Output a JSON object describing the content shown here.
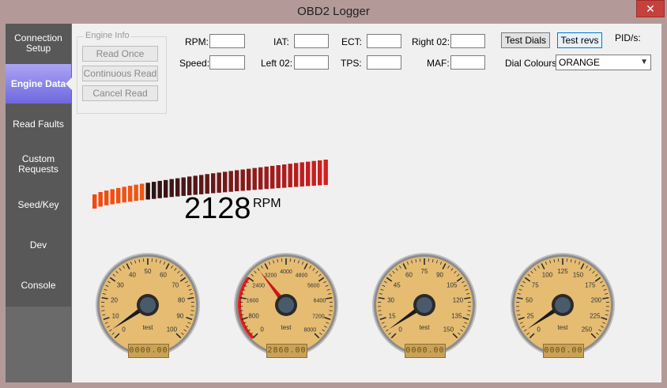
{
  "window": {
    "title": "OBD2 Logger",
    "close_glyph": "✕"
  },
  "sidebar": {
    "items": [
      {
        "label": "Connection Setup",
        "active": false
      },
      {
        "label": "Engine Data",
        "active": true
      },
      {
        "label": "Read Faults",
        "active": false
      },
      {
        "label": "Custom Requests",
        "active": false
      },
      {
        "label": "Seed/Key",
        "active": false
      },
      {
        "label": "Dev",
        "active": false
      },
      {
        "label": "Console",
        "active": false
      }
    ]
  },
  "engine_info": {
    "title": "Engine Info",
    "read_once": "Read Once",
    "continuous_read": "Continuous Read",
    "cancel_read": "Cancel Read"
  },
  "fields": {
    "rpm": {
      "label": "RPM:",
      "value": ""
    },
    "speed": {
      "label": "Speed:",
      "value": ""
    },
    "iat": {
      "label": "IAT:",
      "value": ""
    },
    "left_o2": {
      "label": "Left 02:",
      "value": ""
    },
    "ect": {
      "label": "ECT:",
      "value": ""
    },
    "tps": {
      "label": "TPS:",
      "value": ""
    },
    "right_o2": {
      "label": "Right 02:",
      "value": ""
    },
    "maf": {
      "label": "MAF:",
      "value": ""
    }
  },
  "controls": {
    "test_dials": "Test Dials",
    "test_revs": "Test revs",
    "pids_label": "PID/s:",
    "dial_colours_label": "Dial Colours:",
    "dial_colours_value": "ORANGE",
    "dropdown_arrow": "▼"
  },
  "rpm_bar": {
    "value": "2128",
    "unit": "RPM",
    "segments": 40,
    "lit_fraction": 0.23
  },
  "colors": {
    "accent_active": "#7a73e6",
    "dial_face": "#e5bc72",
    "redline": "#e02020",
    "bar_orange": "#f04a10",
    "bar_red": "#d42020"
  },
  "gauges": [
    {
      "ticks": [
        "0",
        "10",
        "20",
        "30",
        "40",
        "50",
        "60",
        "70",
        "80",
        "90",
        "100"
      ],
      "label": "test",
      "needle_fraction": 0.04,
      "odometer": "0000.00",
      "redline": false
    },
    {
      "ticks": [
        "0",
        "800",
        "1600",
        "2400",
        "3200",
        "4000",
        "4800",
        "5600",
        "6400",
        "7200",
        "8000"
      ],
      "label": "test",
      "needle_fraction": 0.36,
      "odometer": "2860.00",
      "redline": true
    },
    {
      "ticks": [
        "0",
        "15",
        "30",
        "45",
        "60",
        "75",
        "90",
        "105",
        "120",
        "135",
        "150"
      ],
      "label": "test",
      "needle_fraction": 0.04,
      "odometer": "0000.00",
      "redline": false
    },
    {
      "ticks": [
        "0",
        "25",
        "50",
        "75",
        "100",
        "125",
        "150",
        "175",
        "200",
        "225",
        "250"
      ],
      "label": "test",
      "needle_fraction": 0.04,
      "odometer": "0000.00",
      "redline": false
    }
  ]
}
